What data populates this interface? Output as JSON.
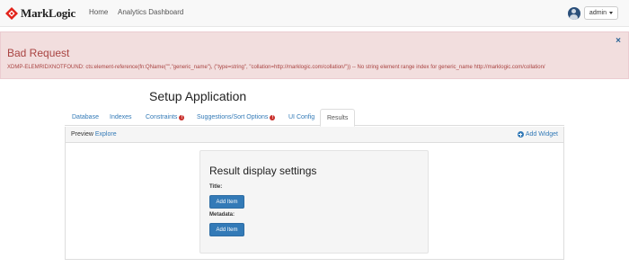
{
  "navbar": {
    "brand": "MarkLogic",
    "links": [
      "Home",
      "Analytics Dashboard"
    ],
    "user": "admin",
    "logo_color": "#e2231a"
  },
  "alert": {
    "title": "Bad Request",
    "message": "XDMP-ELEMRIDXNOTFOUND: cts:element-reference(fn:QName(\"\",\"generic_name\"), (\"type=string\", \"collation=http://marklogic.com/collation/\")) -- No string element range index for generic_name http://marklogic.com/collation/",
    "close": "×",
    "bg_color": "#f2dede",
    "text_color": "#a94442"
  },
  "page_title": "Setup Application",
  "tabs": [
    {
      "label": "Database",
      "warning": false
    },
    {
      "label": "Indexes",
      "warning": false
    },
    {
      "label": "Constraints",
      "warning": true
    },
    {
      "label": "Suggestions/Sort Options",
      "warning": true
    },
    {
      "label": "UI Config",
      "warning": false
    },
    {
      "label": "Results",
      "warning": false,
      "active": true
    }
  ],
  "warning_glyph": "!",
  "panel": {
    "preview": "Preview",
    "explore": "Explore",
    "add_widget": "Add Widget"
  },
  "settings": {
    "title": "Result display settings",
    "title_label": "Title:",
    "metadata_label": "Metadata:",
    "add_item": "Add Item",
    "button_color": "#337ab7"
  }
}
